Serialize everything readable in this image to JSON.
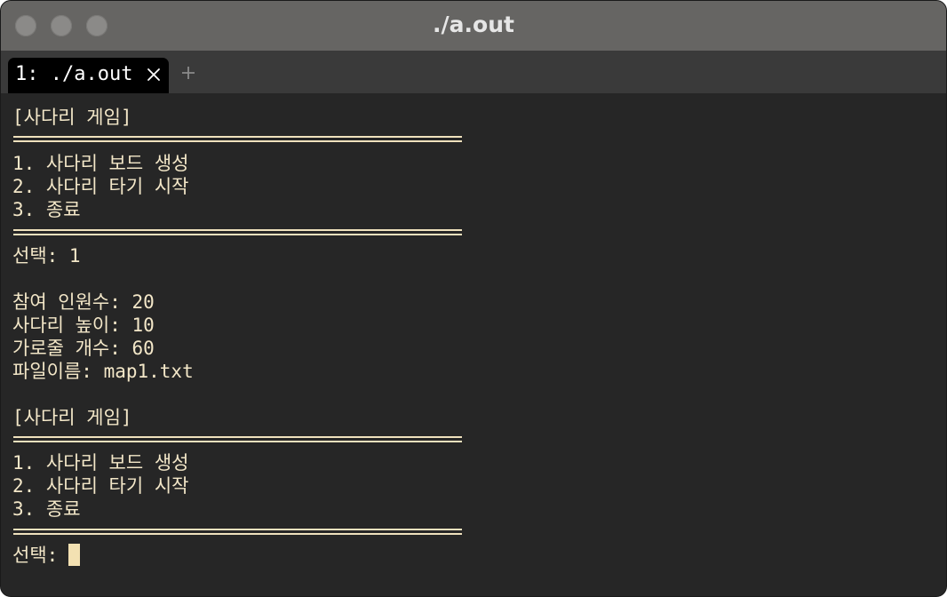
{
  "window": {
    "title": "./a.out"
  },
  "tabs": [
    {
      "label": "1: ./a.out",
      "active": true
    }
  ],
  "icons": {
    "close": "close-icon",
    "new_tab": "plus-icon"
  },
  "colors": {
    "terminal_bg": "#262626",
    "terminal_fg": "#f3e7c8",
    "titlebar_bg": "#666563",
    "tabbar_bg": "#3a3a3a",
    "cursor": "#f3e1b2"
  },
  "terminal": {
    "block1": {
      "header": "[사다리 게임]",
      "menu1": "1. 사다리 보드 생성",
      "menu2": "2. 사다리 타기 시작",
      "menu3": "3. 종료",
      "prompt": "선택: 1"
    },
    "info": {
      "participants": "참여 인원수: 20",
      "height": "사다리 높이: 10",
      "rungs": "가로줄 개수: 60",
      "filename": "파일이름: map1.txt"
    },
    "block2": {
      "header": "[사다리 게임]",
      "menu1": "1. 사다리 보드 생성",
      "menu2": "2. 사다리 타기 시작",
      "menu3": "3. 종료",
      "prompt": "선택:"
    }
  }
}
